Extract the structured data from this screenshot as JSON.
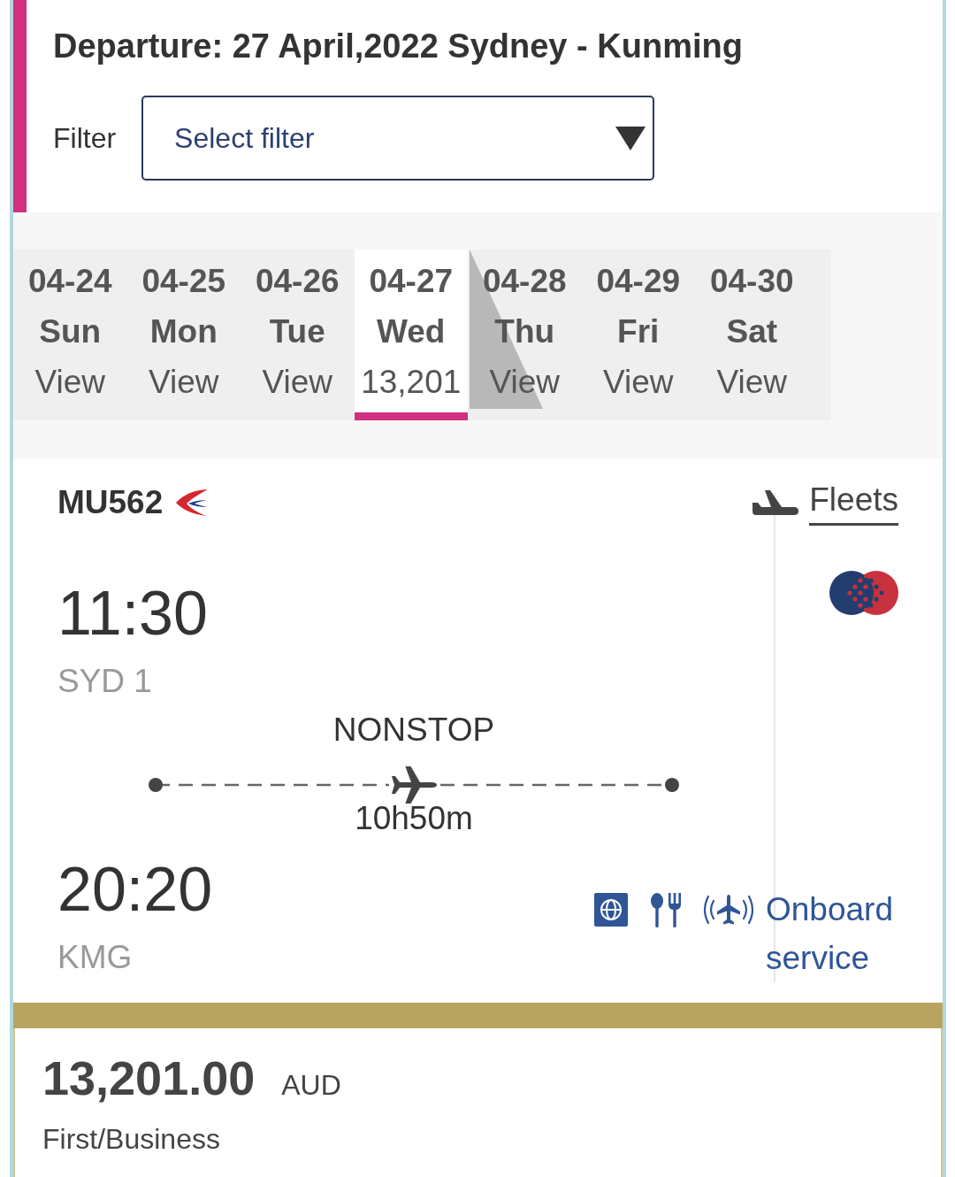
{
  "header": {
    "title": "Departure: 27 April,2022 Sydney - Kunming",
    "filter": {
      "label": "Filter",
      "placeholder": "Select filter"
    }
  },
  "dates": [
    {
      "date": "04-24",
      "weekday": "Sun",
      "price": "View",
      "selected": false
    },
    {
      "date": "04-25",
      "weekday": "Mon",
      "price": "View",
      "selected": false
    },
    {
      "date": "04-26",
      "weekday": "Tue",
      "price": "View",
      "selected": false
    },
    {
      "date": "04-27",
      "weekday": "Wed",
      "price": "13,201",
      "selected": true
    },
    {
      "date": "04-28",
      "weekday": "Thu",
      "price": "View",
      "selected": false
    },
    {
      "date": "04-29",
      "weekday": "Fri",
      "price": "View",
      "selected": false
    },
    {
      "date": "04-30",
      "weekday": "Sat",
      "price": "View",
      "selected": false
    }
  ],
  "flight": {
    "number": "MU562",
    "fleets_link": "Fleets",
    "departure": {
      "time": "11:30",
      "airport": "SYD 1"
    },
    "stops": "NONSTOP",
    "duration": "10h50m",
    "arrival": {
      "time": "20:20",
      "airport": "KMG"
    },
    "onboard_service_link": "Onboard service"
  },
  "fare": {
    "price": "13,201.00",
    "currency": "AUD",
    "cabin": "First/Business"
  }
}
